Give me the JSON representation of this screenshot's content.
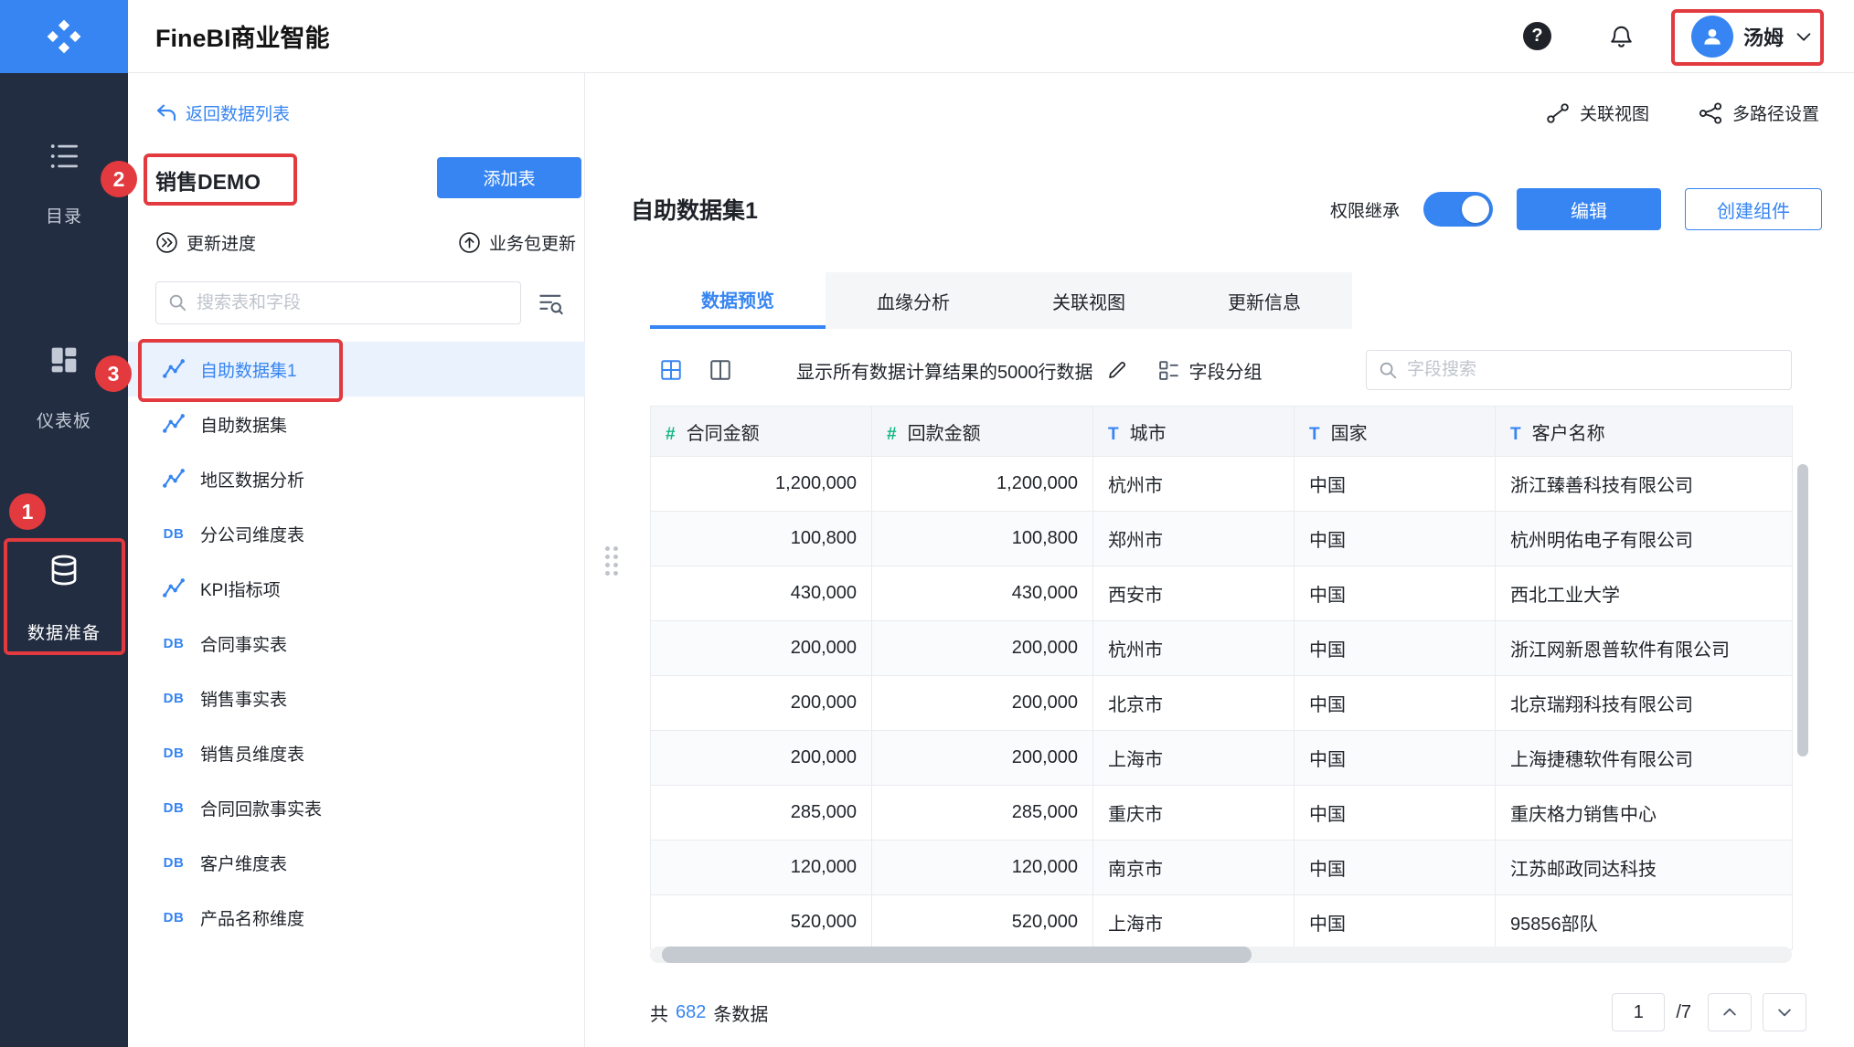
{
  "topbar": {
    "title": "FineBI商业智能",
    "user_name": "汤姆"
  },
  "sidebar": {
    "items": [
      {
        "label": "目录"
      },
      {
        "label": "仪表板"
      },
      {
        "label": "数据准备"
      }
    ]
  },
  "panel": {
    "back_link": "返回数据列表",
    "package_title": "销售DEMO",
    "add_table_button": "添加表",
    "update_progress": "更新进度",
    "package_update": "业务包更新",
    "search_placeholder": "搜索表和字段",
    "items": [
      {
        "label": "自助数据集1",
        "type": "chart",
        "selected": true
      },
      {
        "label": "自助数据集",
        "type": "chart"
      },
      {
        "label": "地区数据分析",
        "type": "chart"
      },
      {
        "label": "分公司维度表",
        "type": "db"
      },
      {
        "label": "KPI指标项",
        "type": "chart"
      },
      {
        "label": "合同事实表",
        "type": "db"
      },
      {
        "label": "销售事实表",
        "type": "db"
      },
      {
        "label": "销售员维度表",
        "type": "db"
      },
      {
        "label": "合同回款事实表",
        "type": "db"
      },
      {
        "label": "客户维度表",
        "type": "db"
      },
      {
        "label": "产品名称维度",
        "type": "db"
      }
    ]
  },
  "main": {
    "related_view_link": "关联视图",
    "multipath_link": "多路径设置",
    "title": "自助数据集1",
    "permission_label": "权限继承",
    "edit_button": "编辑",
    "create_component_button": "创建组件",
    "tabs": [
      {
        "label": "数据预览"
      },
      {
        "label": "血缘分析"
      },
      {
        "label": "关联视图"
      },
      {
        "label": "更新信息"
      }
    ],
    "toolbar": {
      "rows_info": "显示所有数据计算结果的5000行数据",
      "field_group": "字段分组",
      "field_search_placeholder": "字段搜索"
    },
    "table": {
      "columns": [
        {
          "label": "合同金额",
          "type": "number"
        },
        {
          "label": "回款金额",
          "type": "number"
        },
        {
          "label": "城市",
          "type": "text"
        },
        {
          "label": "国家",
          "type": "text"
        },
        {
          "label": "客户名称",
          "type": "text"
        }
      ],
      "rows": [
        [
          "1,200,000",
          "1,200,000",
          "杭州市",
          "中国",
          "浙江臻善科技有限公司"
        ],
        [
          "100,800",
          "100,800",
          "郑州市",
          "中国",
          "杭州明佑电子有限公司"
        ],
        [
          "430,000",
          "430,000",
          "西安市",
          "中国",
          "西北工业大学"
        ],
        [
          "200,000",
          "200,000",
          "杭州市",
          "中国",
          "浙江网新恩普软件有限公司"
        ],
        [
          "200,000",
          "200,000",
          "北京市",
          "中国",
          "北京瑞翔科技有限公司"
        ],
        [
          "200,000",
          "200,000",
          "上海市",
          "中国",
          "上海捷穗软件有限公司"
        ],
        [
          "285,000",
          "285,000",
          "重庆市",
          "中国",
          "重庆格力销售中心"
        ],
        [
          "120,000",
          "120,000",
          "南京市",
          "中国",
          "江苏邮政同达科技"
        ],
        [
          "520,000",
          "520,000",
          "上海市",
          "中国",
          "95856部队"
        ]
      ]
    },
    "footer": {
      "total_prefix": "共",
      "total_count": "682",
      "total_suffix": "条数据",
      "page_value": "1",
      "page_total": "/7"
    }
  },
  "annotations": {
    "badge1": "1",
    "badge2": "2",
    "badge3": "3"
  },
  "colors": {
    "accent": "#3685F2",
    "annotation_red": "#E23A3E",
    "numeric_green": "#12B784",
    "sidebar_dark": "#222D42"
  }
}
